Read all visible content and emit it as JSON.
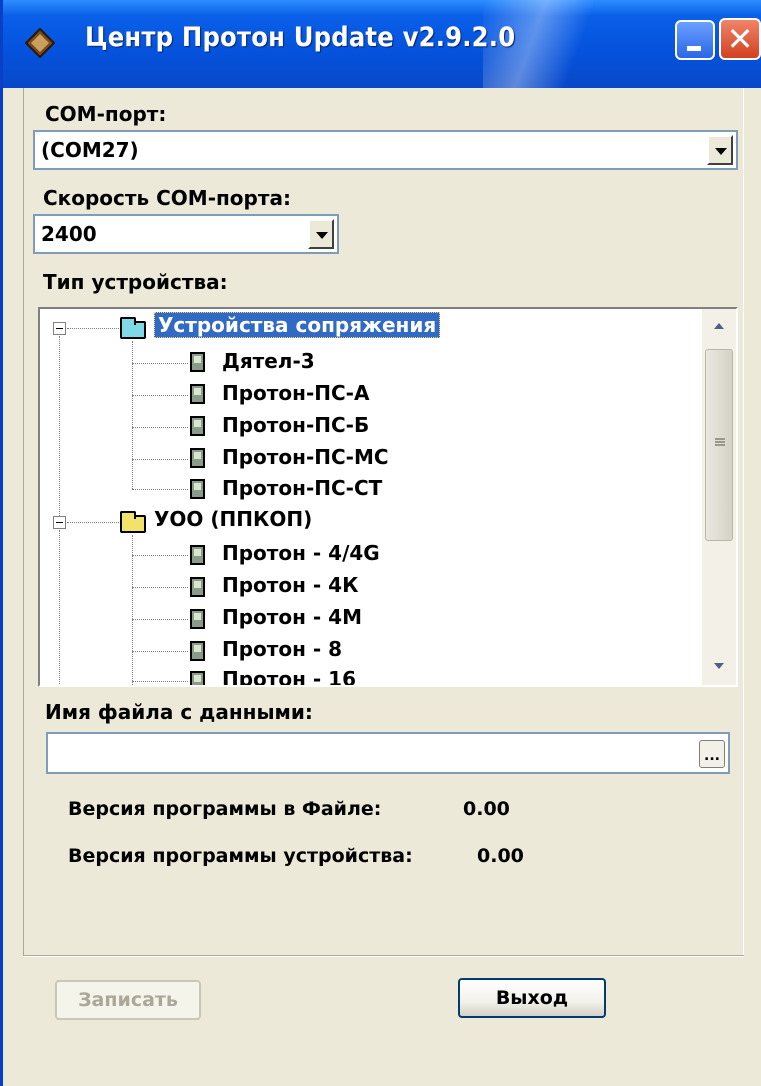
{
  "window": {
    "title": "Центр Протон Update v2.9.2.0"
  },
  "com_port": {
    "label": "COM-порт:",
    "value": "(COM27)"
  },
  "com_speed": {
    "label": "Скорость COM-порта:",
    "value": "2400"
  },
  "device_type": {
    "label": "Тип устройства:",
    "groups": [
      {
        "label": "Устройства сопряжения",
        "items": [
          "Дятел-3",
          "Протон-ПС-А",
          "Протон-ПС-Б",
          "Протон-ПС-МС",
          "Протон-ПС-СТ"
        ]
      },
      {
        "label": "УОО (ППКОП)",
        "items": [
          "Протон - 4/4G",
          "Протон - 4К",
          "Протон - 4М",
          "Протон - 8",
          "Протон - 16"
        ]
      }
    ]
  },
  "data_file": {
    "label": "Имя файла с данными:",
    "value": "",
    "browse_label": "..."
  },
  "versions": {
    "file_label": "Версия программы в Файле:",
    "file_value": "0.00",
    "device_label": "Версия программы устройства:",
    "device_value": "0.00"
  },
  "buttons": {
    "write": "Записать",
    "exit": "Выход"
  },
  "colors": {
    "titlebar": "#0552DC",
    "selection": "#316AC5",
    "folder_selected": "#7FD8E6",
    "folder": "#F0E26A"
  }
}
